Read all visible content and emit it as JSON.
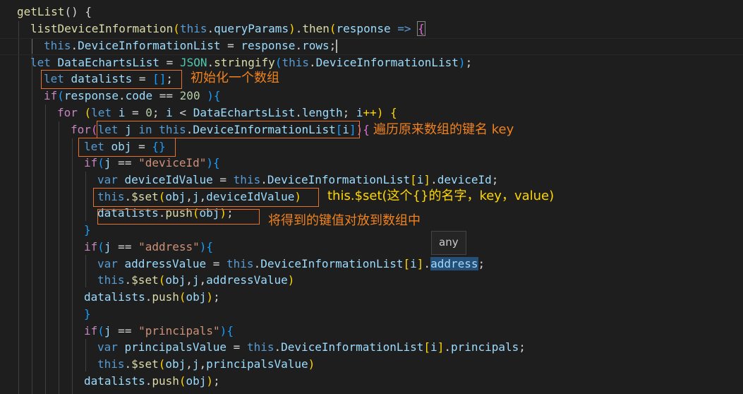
{
  "code": {
    "l1": {
      "a": "getList",
      "b": "() {"
    },
    "l2": {
      "a": "listDeviceInformation",
      "b": "(",
      "c": "this",
      "d": ".",
      "e": "queryParams",
      "f": ")",
      "g": ".",
      "h": "then",
      "i": "(",
      "j": "response",
      "k": " => ",
      "l": "{"
    },
    "l3": {
      "a": "this",
      "b": ".",
      "c": "DeviceInformationList",
      "d": " = ",
      "e": "response",
      "f": ".",
      "g": "rows",
      "h": ";"
    },
    "l4": {
      "a": "let ",
      "b": "DataEchartsList",
      "c": " = ",
      "d": "JSON",
      "e": ".",
      "f": "stringify",
      "g": "(",
      "h": "this",
      "i": ".",
      "j": "DeviceInformationList",
      "k": ")",
      "l": ";"
    },
    "l5": {
      "a": "let ",
      "b": "datalists",
      "c": " = ",
      "d": "[]",
      "e": ";"
    },
    "l6": {
      "a": "if",
      "b": "(",
      "c": "response",
      "d": ".",
      "e": "code",
      "f": " == ",
      "g": "200",
      "h": " )",
      "i": "{"
    },
    "l7": {
      "a": "for",
      "b": " (",
      "c": "let ",
      "d": "i",
      "e": " = ",
      "f": "0",
      "g": "; ",
      "h": "i",
      "i": " < ",
      "j": "DataEchartsList",
      "k": ".",
      "l": "length",
      "m": "; ",
      "n": "i",
      "o": "++) ",
      "p": "{"
    },
    "l8": {
      "a": "for",
      "b": "(",
      "c": "let ",
      "d": "j",
      "e": " in ",
      "f": "this",
      "g": ".",
      "h": "DeviceInformationList",
      "i": "[",
      "j": "i",
      "k": "]",
      "l": ")",
      "m": "{"
    },
    "l9": {
      "a": "let ",
      "b": "obj",
      "c": " = ",
      "d": "{}"
    },
    "l10": {
      "a": "if",
      "b": "(",
      "c": "j",
      "d": " == ",
      "e": "\"deviceId\"",
      "f": ")",
      "g": "{"
    },
    "l11": {
      "a": "var ",
      "b": "deviceIdValue",
      "c": " = ",
      "d": "this",
      "e": ".",
      "f": "DeviceInformationList",
      "g": "[",
      "h": "i",
      "i": "]",
      "j": ".",
      "k": "deviceId",
      "l": ";"
    },
    "l12": {
      "a": "this",
      "b": ".",
      "c": "$set",
      "d": "(",
      "e": "obj",
      "f": ",",
      "g": "j",
      "h": ",",
      "i": "deviceIdValue",
      "j": ")"
    },
    "l13": {
      "a": "datalists",
      "b": ".",
      "c": "push",
      "d": "(",
      "e": "obj",
      "f": ")",
      "g": ";"
    },
    "l14": {
      "a": "}"
    },
    "l15": {
      "a": "if",
      "b": "(",
      "c": "j",
      "d": " == ",
      "e": "\"address\"",
      "f": ")",
      "g": "{"
    },
    "l16": {
      "a": "var ",
      "b": "addressValue",
      "c": " = ",
      "d": "this",
      "e": ".",
      "f": "DeviceInformationList",
      "g": "[",
      "h": "i",
      "i": "]",
      "j": ".",
      "k": "address",
      "l": ";"
    },
    "l17": {
      "a": "this",
      "b": ".",
      "c": "$set",
      "d": "(",
      "e": "obj",
      "f": ",",
      "g": "j",
      "h": ",",
      "i": "addressValue",
      "j": ")"
    },
    "l18": {
      "a": "datalists",
      "b": ".",
      "c": "push",
      "d": "(",
      "e": "obj",
      "f": ")",
      "g": ";"
    },
    "l19": {
      "a": "}"
    },
    "l20": {
      "a": "if",
      "b": "(",
      "c": "j",
      "d": " == ",
      "e": "\"principals\"",
      "f": ")",
      "g": "{"
    },
    "l21": {
      "a": "var ",
      "b": "principalsValue",
      "c": " = ",
      "d": "this",
      "e": ".",
      "f": "DeviceInformationList",
      "g": "[",
      "h": "i",
      "i": "]",
      "j": ".",
      "k": "principals",
      "l": ";"
    },
    "l22": {
      "a": "this",
      "b": ".",
      "c": "$set",
      "d": "(",
      "e": "obj",
      "f": ",",
      "g": "j",
      "h": ",",
      "i": "principalsValue",
      "j": ")"
    },
    "l23": {
      "a": "datalists",
      "b": ".",
      "c": "push",
      "d": "(",
      "e": "obj",
      "f": ")",
      "g": ";"
    }
  },
  "annotations": {
    "init_array": "初始化一个数组",
    "iterate_keys": "遍历原来数组的键名 key",
    "set_usage": "this.$set(这个{}的名字，key，value)",
    "push_note": "将得到的键值对放到数组中"
  },
  "tooltip": {
    "text": "any"
  },
  "colors": {
    "background": "#1e1e1e",
    "keyword": "#569cd6",
    "control": "#c586c0",
    "function": "#dcdcaa",
    "variable": "#9cdcfe",
    "string": "#ce9178",
    "number": "#b5cea8",
    "annotation": "#f0821e"
  }
}
